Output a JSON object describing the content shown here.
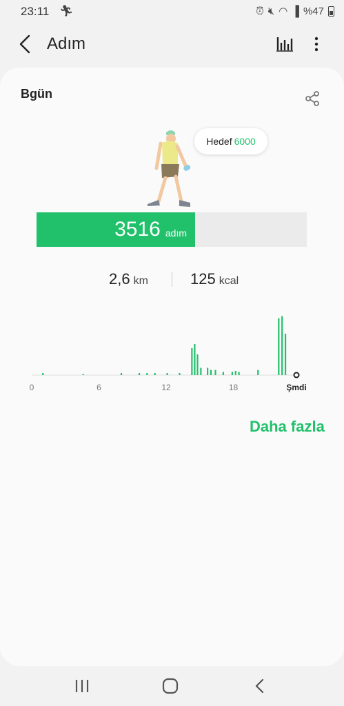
{
  "status_bar": {
    "time": "23:11",
    "battery": "%47"
  },
  "app_bar": {
    "title": "Adım"
  },
  "card": {
    "date_label": "Bgün",
    "goal": {
      "label": "Hedef",
      "value": "6000"
    },
    "steps": {
      "value": "3516",
      "unit": "adım",
      "progress_fraction": 0.586
    },
    "distance": {
      "value": "2,6",
      "unit": "km"
    },
    "calories": {
      "value": "125",
      "unit": "kcal"
    },
    "more_label": "Daha fazla"
  },
  "colors": {
    "accent": "#21c16b",
    "track": "#ebebeb",
    "background": "#f2f2f2"
  },
  "chart_data": {
    "type": "bar",
    "x_ticks": [
      "0",
      "6",
      "12",
      "18",
      "Şmdi"
    ],
    "x": [
      1.0,
      4.6,
      8.0,
      9.6,
      10.3,
      11.0,
      12.1,
      13.2,
      14.3,
      14.55,
      14.8,
      15.1,
      15.7,
      16.0,
      16.4,
      17.1,
      17.9,
      18.2,
      18.5,
      20.2,
      22.05,
      22.35,
      22.65
    ],
    "values": [
      2,
      1,
      2,
      2,
      2,
      2,
      2,
      2,
      26,
      30,
      20,
      7,
      7,
      5,
      5,
      3,
      3,
      4,
      3,
      5,
      55,
      57,
      40
    ],
    "xlim": [
      0,
      24
    ],
    "ylim": [
      0,
      60
    ]
  }
}
